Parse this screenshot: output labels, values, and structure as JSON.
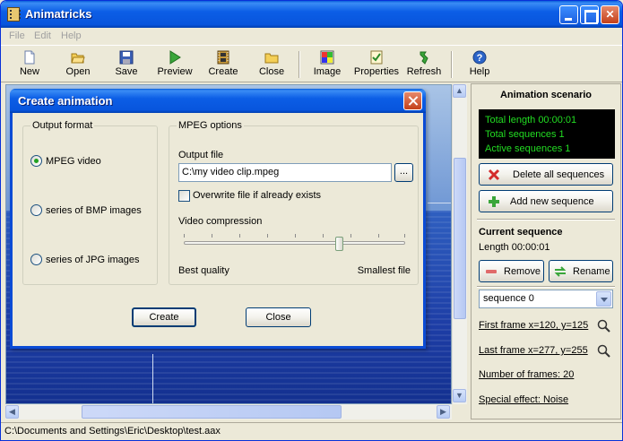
{
  "window": {
    "title": "Animatricks"
  },
  "menu": {
    "items": [
      "File",
      "Edit",
      "Help"
    ]
  },
  "toolbar": {
    "buttons": [
      {
        "label": "New",
        "icon": "new-document-icon"
      },
      {
        "label": "Open",
        "icon": "open-folder-icon"
      },
      {
        "label": "Save",
        "icon": "floppy-disk-icon"
      },
      {
        "label": "Preview",
        "icon": "play-icon"
      },
      {
        "label": "Create",
        "icon": "film-strip-icon"
      },
      {
        "label": "Close",
        "icon": "close-folder-icon"
      },
      {
        "label": "Image",
        "icon": "image-icon"
      },
      {
        "label": "Properties",
        "icon": "checklist-icon"
      },
      {
        "label": "Refresh",
        "icon": "refresh-icon"
      },
      {
        "label": "Help",
        "icon": "help-icon"
      }
    ]
  },
  "status": {
    "path": "C:\\Documents and Settings\\Eric\\Desktop\\test.aax"
  },
  "scenario": {
    "header": "Animation scenario",
    "total_length": "Total length 00:00:01",
    "total_sequences": "Total sequences 1",
    "active_sequences": "Active sequences 1",
    "delete_all_label": "Delete all sequences",
    "add_new_label": "Add new sequence"
  },
  "current_sequence": {
    "header": "Current sequence",
    "length": "Length 00:00:01",
    "remove_label": "Remove",
    "rename_label": "Rename",
    "selected": "sequence 0",
    "first_frame": "First frame x=120, y=125",
    "last_frame": "Last frame x=277, y=255",
    "number_of_frames": "Number of frames: 20",
    "special_effect": "Special effect: Noise"
  },
  "dialog": {
    "title": "Create animation",
    "output_format": {
      "label": "Output format",
      "options": [
        "MPEG video",
        "series of BMP images",
        "series of JPG images"
      ],
      "selected": "MPEG video"
    },
    "mpeg_options": {
      "label": "MPEG options",
      "output_file_label": "Output file",
      "output_file_value": "C:\\my video clip.mpeg",
      "browse_label": "...",
      "overwrite_label": "Overwrite file if already exists",
      "overwrite_checked": false,
      "compression_label": "Video compression",
      "compression_level": 0.7,
      "best_quality_label": "Best quality",
      "smallest_file_label": "Smallest file"
    },
    "create_label": "Create",
    "close_label": "Close"
  },
  "colors": {
    "titlebar": "#0855dd",
    "info_text": "#22dd22",
    "info_bg": "#000000"
  }
}
